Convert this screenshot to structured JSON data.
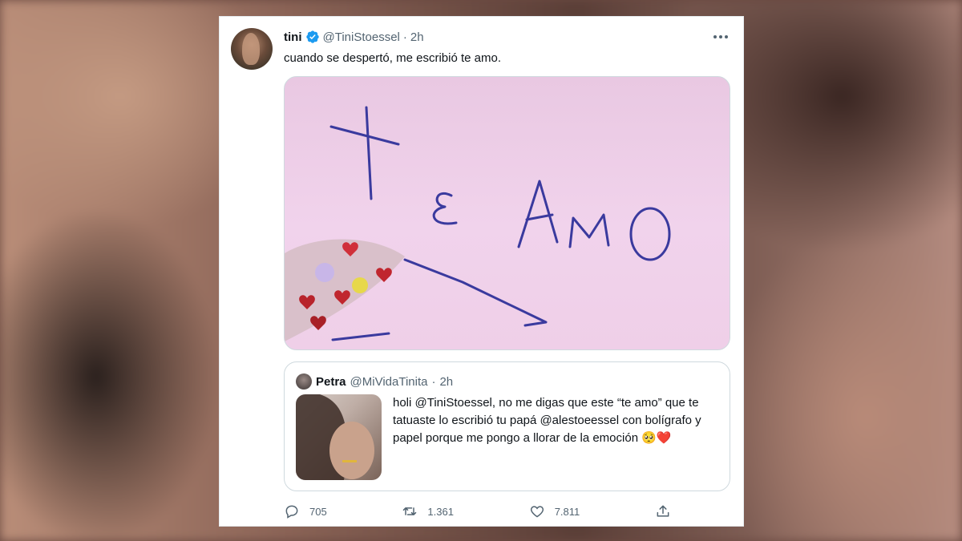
{
  "tweet": {
    "author_name": "tini",
    "author_handle": "@TiniStoessel",
    "separator": "·",
    "time": "2h",
    "text": "cuando se despertó, me escribió te amo.",
    "image_text": "TE AMO"
  },
  "quoted": {
    "author_name": "Petra",
    "author_handle": "@MiVidaTinita",
    "separator": "·",
    "time": "2h",
    "text": "holi @TiniStoessel, no me digas que este “te amo” que te tatuaste lo escribió tu papá @alestoeessel con bolígrafo y papel porque me pongo a llorar de la emoción 🥺❤️"
  },
  "actions": {
    "replies": "705",
    "retweets": "1.361",
    "likes": "7.811"
  },
  "colors": {
    "verified": "#1d9bf0",
    "text": "#0f1419",
    "secondary": "#536471"
  },
  "icons": [
    "verified-icon",
    "more-icon",
    "reply-icon",
    "retweet-icon",
    "like-icon",
    "share-icon"
  ]
}
